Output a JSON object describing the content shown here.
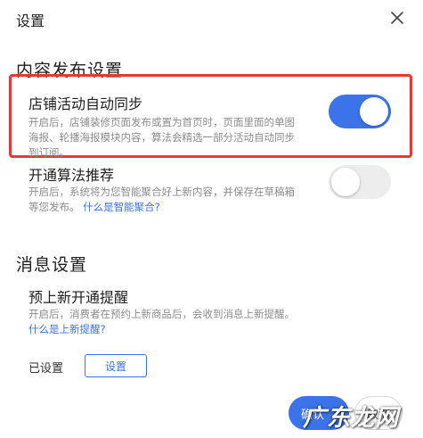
{
  "dialog": {
    "title": "设置",
    "close_icon": "close-icon"
  },
  "content_section": {
    "title": "内容发布设置",
    "items": [
      {
        "title": "店铺活动自动同步",
        "description": "开启后，店铺装修页面发布或置为首页时，页面里面的单图海报、轮播海报模块内容，算法会精选一部分活动自动同步到订阅。",
        "enabled": true
      },
      {
        "title": "开通算法推荐",
        "description": "开启后，系统将为您智能聚合好上新内容，并保存在草稿箱等您发布。",
        "link": "什么是智能聚合?",
        "enabled": false
      }
    ]
  },
  "message_section": {
    "title": "消息设置",
    "item": {
      "title": "预上新开通提醒",
      "description": "开启后，消费者在预约上新商品后，会收到消息上新提醒。",
      "link": "什么是上新提醒?"
    },
    "status_label": "已设置",
    "set_button_label": "设置"
  },
  "footer": {
    "confirm_label": "确认",
    "cancel_label": "取消"
  },
  "watermark": "广东龙网",
  "colors": {
    "accent": "#3b73e8",
    "highlight_border": "#e53935",
    "muted_text": "#8c8c8c",
    "toggle_off": "#ededed"
  }
}
